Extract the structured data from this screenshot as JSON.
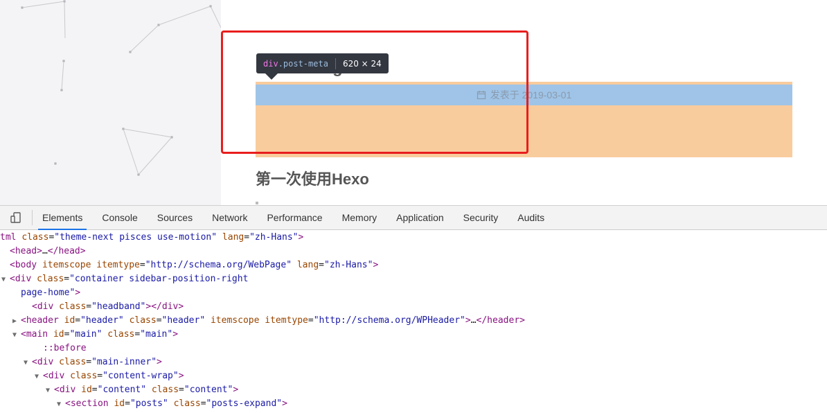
{
  "page": {
    "hidden_title_fragment": "g",
    "meta_text": "发表于 2019-03-01",
    "second_post_title": "第一次使用Hexo"
  },
  "tooltip": {
    "tag": "div",
    "class": ".post-meta",
    "size": "620 × 24"
  },
  "devtools": {
    "tabs": [
      "Elements",
      "Console",
      "Sources",
      "Network",
      "Performance",
      "Memory",
      "Application",
      "Security",
      "Audits"
    ],
    "active_tab": "Elements",
    "lines": [
      {
        "html": "<span class='p'>tml</span> <span class='a'>class</span>=<span class='v'>\"theme-next pisces use-motion\"</span> <span class='a'>lang</span>=<span class='v'>\"zh-Hans\"</span><span class='p'>&gt;</span>",
        "indent": 0,
        "tri": ""
      },
      {
        "html": "<span class='t'>&lt;head&gt;</span>…<span class='t'>&lt;/head&gt;</span>",
        "indent": 0,
        "tri": ""
      },
      {
        "html": "<span class='t'>&lt;body</span> <span class='a'>itemscope</span> <span class='a'>itemtype</span>=<span class='v'>\"http://schema.org/WebPage\"</span> <span class='a'>lang</span>=<span class='v'>\"zh-Hans\"</span><span class='t'>&gt;</span>",
        "indent": 0,
        "tri": ""
      },
      {
        "html": "<span class='t'>&lt;div</span> <span class='a'>class</span>=<span class='v'>\"container sidebar-position-right</span>",
        "indent": 0,
        "tri": "▼"
      },
      {
        "html": "<span class='v'>page-home\"</span><span class='t'>&gt;</span>",
        "indent": 1,
        "tri": ""
      },
      {
        "html": "<span class='t'>&lt;div</span> <span class='a'>class</span>=<span class='v'>\"headband\"</span><span class='t'>&gt;&lt;/div&gt;</span>",
        "indent": 2,
        "tri": ""
      },
      {
        "html": "<span class='t'>&lt;header</span> <span class='a'>id</span>=<span class='v'>\"header\"</span> <span class='a'>class</span>=<span class='v'>\"header\"</span> <span class='a'>itemscope</span> <span class='a'>itemtype</span>=<span class='v'>\"http://schema.org/WPHeader\"</span><span class='t'>&gt;</span>…<span class='t'>&lt;/header&gt;</span>",
        "indent": 1,
        "tri": "▶"
      },
      {
        "html": "<span class='t'>&lt;main</span> <span class='a'>id</span>=<span class='v'>\"main\"</span> <span class='a'>class</span>=<span class='v'>\"main\"</span><span class='t'>&gt;</span>",
        "indent": 1,
        "tri": "▼"
      },
      {
        "html": "<span class='t'>::before</span>",
        "indent": 3,
        "tri": ""
      },
      {
        "html": "<span class='t'>&lt;div</span> <span class='a'>class</span>=<span class='v'>\"main-inner\"</span><span class='t'>&gt;</span>",
        "indent": 2,
        "tri": "▼"
      },
      {
        "html": "<span class='t'>&lt;div</span> <span class='a'>class</span>=<span class='v'>\"content-wrap\"</span><span class='t'>&gt;</span>",
        "indent": 3,
        "tri": "▼"
      },
      {
        "html": "<span class='t'>&lt;div</span> <span class='a'>id</span>=<span class='v'>\"content\"</span> <span class='a'>class</span>=<span class='v'>\"content\"</span><span class='t'>&gt;</span>",
        "indent": 4,
        "tri": "▼"
      },
      {
        "html": "<span class='t'>&lt;section</span> <span class='a'>id</span>=<span class='v'>\"posts\"</span> <span class='a'>class</span>=<span class='v'>\"posts-expand\"</span><span class='t'>&gt;</span>",
        "indent": 5,
        "tri": "▼"
      }
    ]
  },
  "colors": {
    "margin_overlay": "#f9cc9d",
    "content_overlay": "#9fc4e7",
    "highlight_border": "#e81d1d",
    "active_tab_underline": "#1a73e8"
  },
  "icons": {
    "device_toggle": "device-toolbar-icon",
    "calendar": "calendar-icon"
  }
}
